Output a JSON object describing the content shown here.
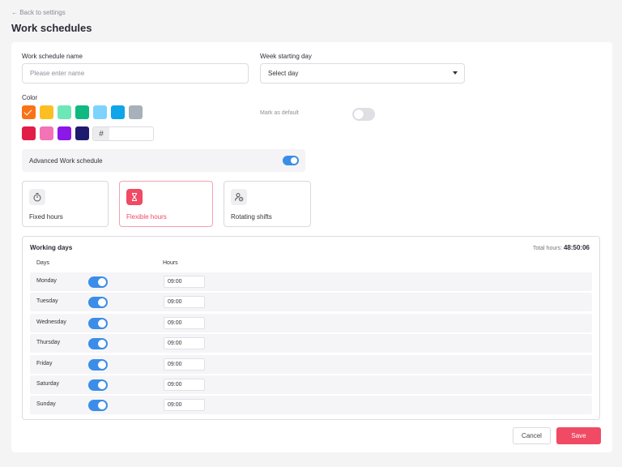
{
  "header": {
    "back_label": "← Back to settings",
    "title": "Work schedules"
  },
  "form": {
    "name_label": "Work schedule name",
    "name_placeholder": "Please enter name",
    "week_label": "Week starting day",
    "week_value": "Select day",
    "color_label": "Color",
    "colors_row1": [
      "#f97316",
      "#fbbf24",
      "#6ee7b7",
      "#10b981",
      "#7dd3fc",
      "#0ea5e9",
      "#a8b0b9"
    ],
    "colors_row2": [
      "#e11d48",
      "#f472b6",
      "#8b17e8",
      "#1e1b6e"
    ],
    "selected_color_index": 0,
    "hex_symbol": "#",
    "hex_value": "",
    "default_label": "Mark as default",
    "default_on": false,
    "advanced_label": "Advanced Work schedule",
    "advanced_on": true
  },
  "schedule_types": [
    {
      "label": "Fixed hours",
      "icon": "stopwatch-icon",
      "active": false
    },
    {
      "label": "Flexible hours",
      "icon": "hourglass-icon",
      "active": true
    },
    {
      "label": "Rotating shifts",
      "icon": "user-clock-icon",
      "active": false
    }
  ],
  "working_days": {
    "title": "Working days",
    "total_label": "Total hours:",
    "total_value": "48:50:06",
    "col_days": "Days",
    "col_hours": "Hours",
    "days": [
      {
        "name": "Monday",
        "enabled": true,
        "hours": "09:00"
      },
      {
        "name": "Tuesday",
        "enabled": true,
        "hours": "09:00"
      },
      {
        "name": "Wednesday",
        "enabled": true,
        "hours": "09:00"
      },
      {
        "name": "Thursday",
        "enabled": true,
        "hours": "09:00"
      },
      {
        "name": "Friday",
        "enabled": true,
        "hours": "09:00"
      },
      {
        "name": "Saturday",
        "enabled": true,
        "hours": "09:00"
      },
      {
        "name": "Sunday",
        "enabled": true,
        "hours": "09:00"
      }
    ]
  },
  "actions": {
    "cancel_label": "Cancel",
    "save_label": "Save"
  },
  "theme": {
    "accent": "#3b8de8",
    "primary": "#f04a64"
  }
}
